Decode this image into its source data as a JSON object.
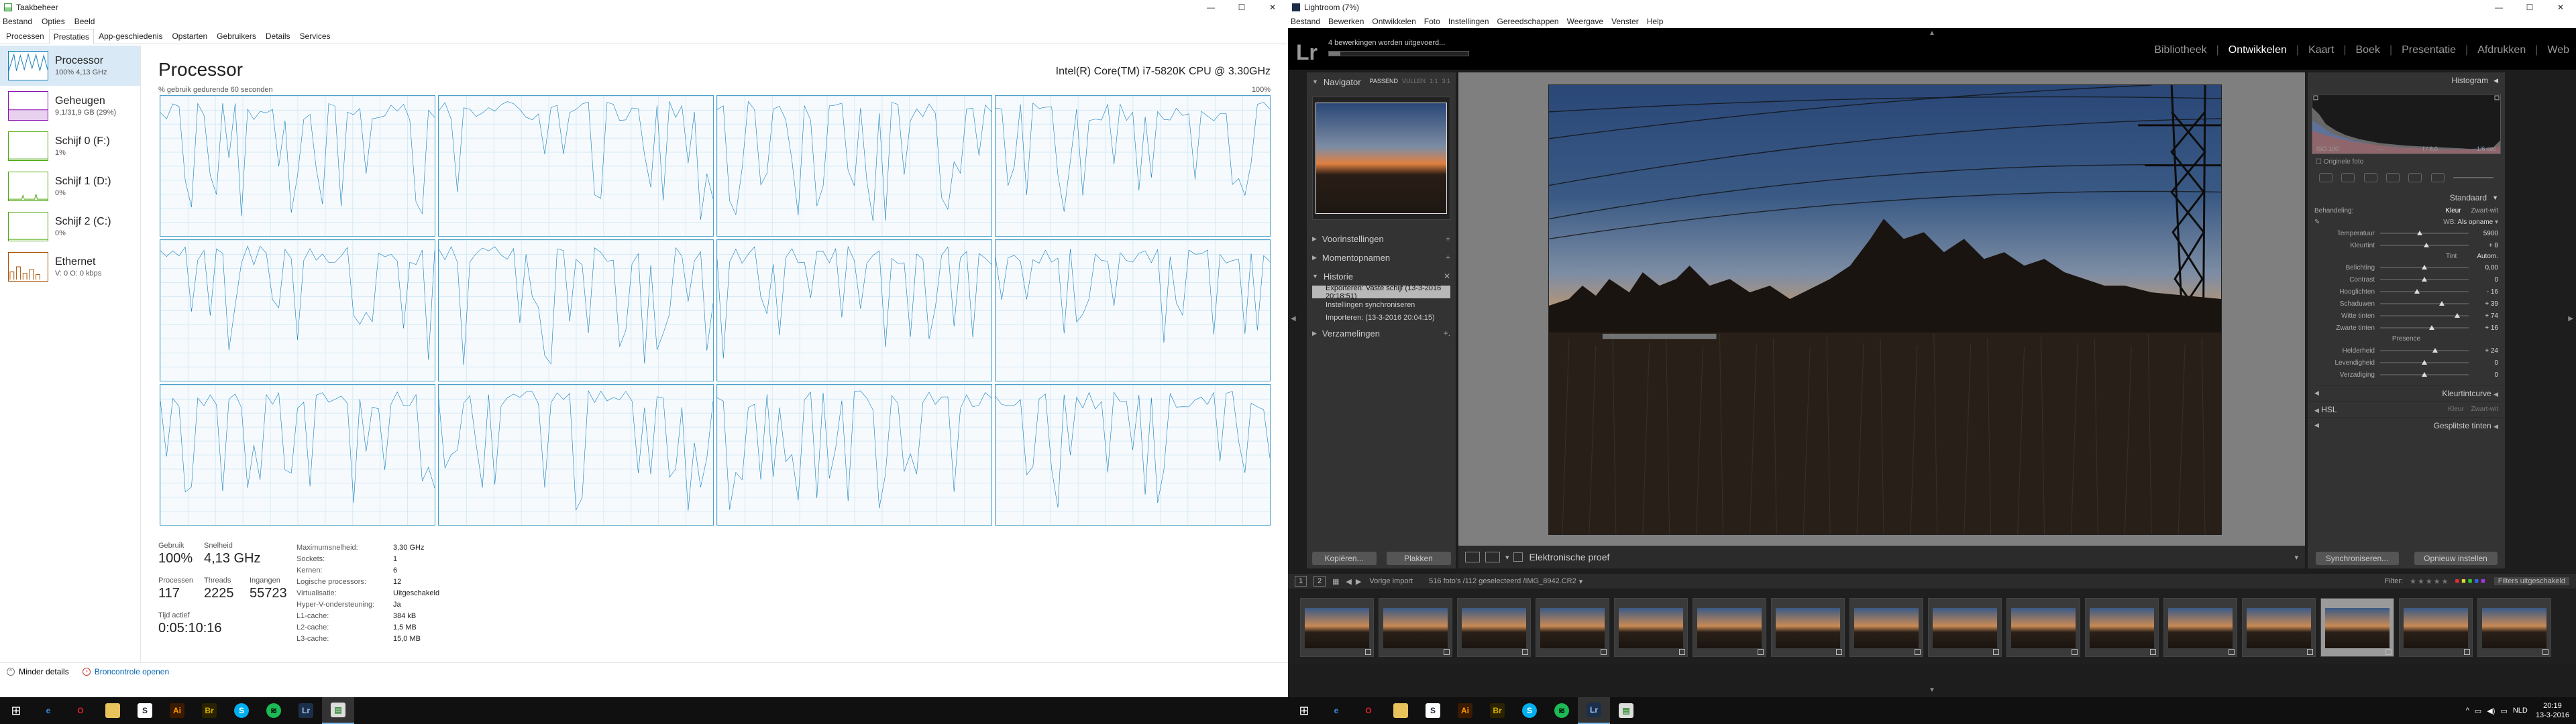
{
  "taskmanager": {
    "title": "Taakbeheer",
    "menu": [
      "Bestand",
      "Opties",
      "Beeld"
    ],
    "tabs": [
      "Processen",
      "Prestaties",
      "App-geschiedenis",
      "Opstarten",
      "Gebruikers",
      "Details",
      "Services"
    ],
    "active_tab": "Prestaties",
    "sidebar": [
      {
        "name": "Processor",
        "sub": "100% 4,13 GHz",
        "color": "#117dbb",
        "active": true
      },
      {
        "name": "Geheugen",
        "sub": "9,1/31,9 GB (29%)",
        "color": "#8b12ae"
      },
      {
        "name": "Schijf 0 (F:)",
        "sub": "1%",
        "color": "#4da60c"
      },
      {
        "name": "Schijf 1 (D:)",
        "sub": "0%",
        "color": "#4da60c"
      },
      {
        "name": "Schijf 2 (C:)",
        "sub": "0%",
        "color": "#4da60c"
      },
      {
        "name": "Ethernet",
        "sub": "V: 0 O: 0 kbps",
        "color": "#a74f01"
      }
    ],
    "main": {
      "title": "Processor",
      "cpu_name": "Intel(R) Core(TM) i7-5820K CPU @ 3.30GHz",
      "graph_label": "% gebruik gedurende 60 seconden",
      "graph_max": "100%",
      "graph_count": 12
    },
    "stats": {
      "gebruik": {
        "label": "Gebruik",
        "value": "100%"
      },
      "snelheid": {
        "label": "Snelheid",
        "value": "4,13 GHz"
      },
      "processen": {
        "label": "Processen",
        "value": "117"
      },
      "threads": {
        "label": "Threads",
        "value": "2225"
      },
      "ingangen": {
        "label": "Ingangen",
        "value": "55723"
      },
      "tijd": {
        "label": "Tijd actief",
        "value": "0:05:10:16"
      }
    },
    "specs": [
      {
        "k": "Maximumsnelheid:",
        "v": "3,30 GHz"
      },
      {
        "k": "Sockets:",
        "v": "1"
      },
      {
        "k": "Kernen:",
        "v": "6"
      },
      {
        "k": "Logische processors:",
        "v": "12"
      },
      {
        "k": "Virtualisatie:",
        "v": "Uitgeschakeld"
      },
      {
        "k": "Hyper-V-ondersteuning:",
        "v": "Ja"
      },
      {
        "k": "L1-cache:",
        "v": "384 kB"
      },
      {
        "k": "L2-cache:",
        "v": "1,5 MB"
      },
      {
        "k": "L3-cache:",
        "v": "15,0 MB"
      }
    ],
    "footer": {
      "less": "Minder details",
      "monitor": "Broncontrole openen"
    }
  },
  "lightroom": {
    "title": "Lightroom (7%)",
    "menu": [
      "Bestand",
      "Bewerken",
      "Ontwikkelen",
      "Foto",
      "Instellingen",
      "Gereedschappen",
      "Weergave",
      "Venster",
      "Help"
    ],
    "logo": "Lr",
    "task": "4 bewerkingen worden uitgevoerd...",
    "progress": 0.08,
    "modules": [
      "Bibliotheek",
      "Ontwikkelen",
      "Kaart",
      "Boek",
      "Presentatie",
      "Afdrukken",
      "Web"
    ],
    "active_module": "Ontwikkelen",
    "left": {
      "navigator": "Navigator",
      "nav_opts": [
        "PASSEND",
        "VULLEN",
        "1:1",
        "3:1"
      ],
      "presets": "Voorinstellingen",
      "snapshots": "Momentopnamen",
      "history": "Historie",
      "history_items": [
        "Exporteren: Vaste schijf (13-3-2016 20:18:51)",
        "Instellingen synchroniseren",
        "Importeren: (13-3-2016 20:04:15)"
      ],
      "collections": "Verzamelingen",
      "copy_btn": "Kopiëren...",
      "paste_btn": "Plakken"
    },
    "toolbar": {
      "proof": "Elektronische proef"
    },
    "right": {
      "histogram": "Histogram",
      "hist_meta": [
        "ISO 100",
        "—",
        "f / 8,0",
        "1/6 sec"
      ],
      "orig": "Originele foto",
      "basic": "Standaard",
      "treatment_label": "Behandeling:",
      "treatment_opts": [
        "Kleur",
        "Zwart-wit"
      ],
      "wb_label": "WB:",
      "wb_value": "Als opname",
      "tone": "Tint",
      "auto": "Autom.",
      "presence": "Presence",
      "sliders_wb": [
        {
          "label": "Temperatuur",
          "val": "5900",
          "pos": 0.45
        },
        {
          "label": "Kleurtint",
          "val": "+ 8",
          "pos": 0.52
        }
      ],
      "sliders_tone": [
        {
          "label": "Belichting",
          "val": "0,00",
          "pos": 0.5
        },
        {
          "label": "Contrast",
          "val": "0",
          "pos": 0.5
        },
        {
          "label": "Hooglichten",
          "val": "- 16",
          "pos": 0.42
        },
        {
          "label": "Schaduwen",
          "val": "+ 39",
          "pos": 0.7
        },
        {
          "label": "Witte tinten",
          "val": "+ 74",
          "pos": 0.87
        },
        {
          "label": "Zwarte tinten",
          "val": "+ 16",
          "pos": 0.58
        }
      ],
      "sliders_presence": [
        {
          "label": "Helderheid",
          "val": "+ 24",
          "pos": 0.62
        },
        {
          "label": "Levendigheid",
          "val": "0",
          "pos": 0.5
        },
        {
          "label": "Verzadiging",
          "val": "0",
          "pos": 0.5
        }
      ],
      "tonecurve": "Kleurtintcurve",
      "hsl": "HSL",
      "hsl_opts": [
        "Kleur",
        "Zwart-wit"
      ],
      "split": "Gesplitste tinten",
      "sync_btn": "Synchroniseren...",
      "reset_btn": "Opnieuw instellen"
    },
    "filmbar": {
      "prev": "Vorige import",
      "count": "516 foto's /112 geselecteerd /IMG_8942.CR2",
      "filter": "Filter:",
      "filter_off": "Filters uitgeschakeld"
    },
    "film_count": 16
  },
  "taskbar": {
    "left_icons": [
      "start",
      "edge",
      "opera",
      "folder",
      "steam",
      "illustrator",
      "photoshop-bridge",
      "skype",
      "spotify",
      "lightroom",
      "taskmanager"
    ],
    "lang": "NLD",
    "time": "20:19",
    "date": "13-3-2016"
  }
}
